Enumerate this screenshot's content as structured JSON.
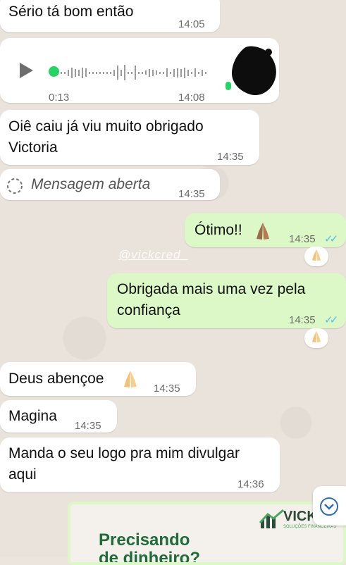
{
  "messages": [
    {
      "id": "m1",
      "text": "Sério tá bom então",
      "time": "14:05"
    },
    {
      "id": "m2",
      "voice": {
        "duration": "0:13",
        "time": "14:08"
      }
    },
    {
      "id": "m3",
      "text_line1": "Oiê caiu já viu muito obrigado",
      "text_line2": "Victoria",
      "time": "14:35"
    },
    {
      "id": "m4",
      "text": "Mensagem aberta",
      "time": "14:35"
    },
    {
      "id": "m5",
      "text": "Ótimo!!",
      "time": "14:35"
    },
    {
      "id": "m6",
      "text_line1": "Obrigada mais uma vez pela",
      "text_line2": "confiança",
      "time": "14:35"
    },
    {
      "id": "m7",
      "text": "Deus abençoe",
      "time": "14:35"
    },
    {
      "id": "m8",
      "text": "Magina",
      "time": "14:35"
    },
    {
      "id": "m9",
      "text_line1": "Manda o seu logo pra mim divulgar",
      "text_line2": "aqui",
      "time": "14:36"
    }
  ],
  "watermark": "@vickcred_",
  "promo": {
    "title_line1": "Precisando",
    "title_line2": "de dinheiro?",
    "brand": "VICKC",
    "brand_sub": "SOLUÇÕES FINANCEIRAS"
  },
  "colors": {
    "incoming": "#ffffff",
    "outgoing": "#dcf8c6",
    "read_ticks": "#53bdeb",
    "play_dot": "#25d366",
    "promo_green": "#1f6b3a"
  },
  "icons": {
    "play": "play-icon",
    "scroll": "chevron-down-icon",
    "loading": "dashed-circle-icon",
    "react": "folded-hands-emoji"
  }
}
